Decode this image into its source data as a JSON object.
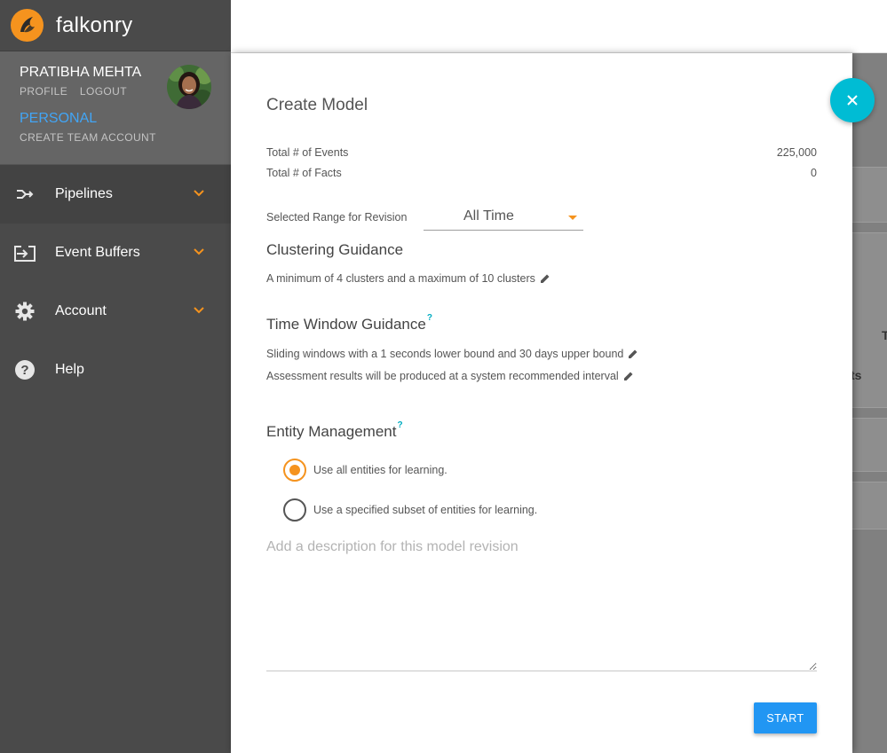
{
  "app": {
    "brand_name": "falkonry",
    "brand_color": "#f5931e"
  },
  "user": {
    "name": "PRATIBHA MEHTA",
    "profile_link": "PROFILE",
    "logout_link": "LOGOUT",
    "account_type": "PERSONAL",
    "create_team_link": "CREATE TEAM ACCOUNT"
  },
  "nav": {
    "items": [
      {
        "label": "Pipelines",
        "icon": "pipeline-merge-icon",
        "has_submenu": true
      },
      {
        "label": "Event Buffers",
        "icon": "input-icon",
        "has_submenu": true
      },
      {
        "label": "Account",
        "icon": "gear-icon",
        "has_submenu": true
      },
      {
        "label": "Help",
        "icon": "help-circle-icon",
        "has_submenu": false
      }
    ]
  },
  "background": {
    "fragment_1": "T",
    "fragment_2": "ts"
  },
  "dialog": {
    "title": "Create Model",
    "stats": [
      {
        "label": "Total # of Events",
        "value": "225,000"
      },
      {
        "label": "Total # of Facts",
        "value": "0"
      }
    ],
    "range": {
      "label": "Selected Range for Revision",
      "value": "All Time"
    },
    "clustering": {
      "title": "Clustering Guidance",
      "text": "A minimum of 4 clusters and a maximum of 10 clusters"
    },
    "time_window": {
      "title": "Time Window Guidance",
      "help": "?",
      "line1": "Sliding windows with a 1 seconds lower bound and 30 days upper bound",
      "line2": "Assessment results will be produced at a system recommended interval"
    },
    "entity": {
      "title": "Entity Management",
      "help": "?",
      "options": [
        {
          "label": "Use all entities for learning.",
          "selected": true
        },
        {
          "label": "Use a specified subset of entities for learning.",
          "selected": false
        }
      ]
    },
    "description": {
      "placeholder": "Add a description for this model revision",
      "value": ""
    },
    "start_label": "START",
    "close_icon": "close-icon"
  },
  "colors": {
    "accent_orange": "#f5931e",
    "close_button": "#00bcd4",
    "start_button": "#2196f3",
    "link_blue": "#42a5f5"
  }
}
